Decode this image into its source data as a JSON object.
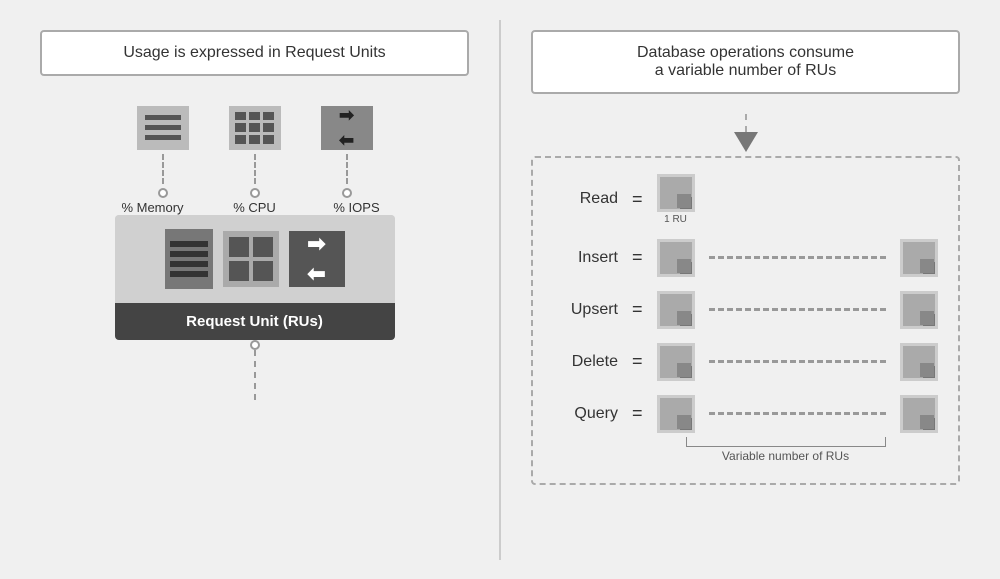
{
  "left": {
    "title": "Usage is expressed in Request Units",
    "metrics": [
      {
        "label": "% Memory"
      },
      {
        "label": "% CPU"
      },
      {
        "label": "% IOPS"
      }
    ],
    "ru_label": "Request Unit (RUs)"
  },
  "right": {
    "title": "Database operations consume\na variable number of RUs",
    "operations": [
      {
        "label": "Read",
        "equals": "=",
        "ru_count": 1,
        "ru_label": "1 RU",
        "dashes": false
      },
      {
        "label": "Insert",
        "equals": "=",
        "dashes": true
      },
      {
        "label": "Upsert",
        "equals": "=",
        "dashes": true
      },
      {
        "label": "Delete",
        "equals": "=",
        "dashes": true
      },
      {
        "label": "Query",
        "equals": "=",
        "dashes": true,
        "long_dashes": true
      }
    ],
    "variable_label": "Variable number of RUs"
  }
}
